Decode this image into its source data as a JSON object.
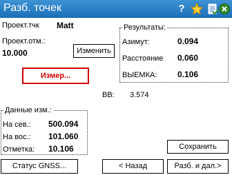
{
  "window": {
    "title": "Разб. точек"
  },
  "project": {
    "file_label": "Проект.тчк",
    "file_value": "Matt",
    "elev_label": "Проект.отм.:",
    "elev_value": "10.000",
    "change_button": "Изменить"
  },
  "measure_button": "Измер...",
  "results": {
    "legend": "Результаты:",
    "azimuth_label": "Азимут:",
    "azimuth_value": "0.094",
    "distance_label": "Расстояние",
    "distance_value": "0.060",
    "cut_label": "ВЫЕМКА:",
    "cut_value": "0.106"
  },
  "bb": {
    "label": "BB:",
    "value": "3.574"
  },
  "measured": {
    "legend": "Данные изм.:",
    "north_label": "На сев.:",
    "north_value": "500.094",
    "east_label": "На вос.:",
    "east_value": "101.060",
    "elev_label": "Отметка:",
    "elev_value": "10.106"
  },
  "buttons": {
    "save": "Сохранить",
    "gnss_status": "Статус GNSS...",
    "back": "< Назад",
    "stake_next": "Разб. и дал.>"
  },
  "colors": {
    "titlebar": "#1a6fb8",
    "measure_accent": "#d00000"
  }
}
